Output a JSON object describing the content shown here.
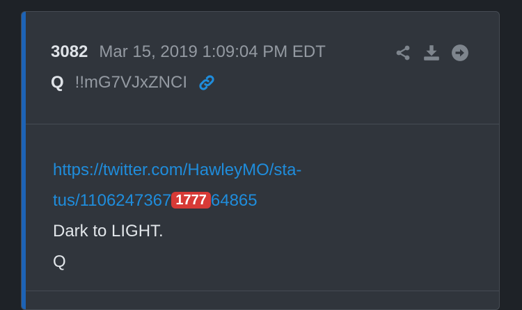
{
  "post": {
    "number": "3082",
    "date": "Mar 15, 2019 1:09:04 PM EDT",
    "author": "Q",
    "tripcode": "!!mG7VJxZNCI",
    "link_line1": "https://twitter.com/HawleyMO/sta-",
    "link_line2_before": "tus/1106247367",
    "link_badge": "1777",
    "link_line2_after": "64865",
    "text_line1": "Dark to LIGHT.",
    "signature": "Q"
  },
  "icons": {
    "share": "share-icon",
    "download": "download-icon",
    "goto": "arrow-right-circle-icon",
    "permalink": "link-icon"
  },
  "colors": {
    "accent": "#1d63b6",
    "link": "#1f8ddc",
    "badge": "#d73a36",
    "card_bg": "#30353c",
    "page_bg": "#1e2227"
  }
}
